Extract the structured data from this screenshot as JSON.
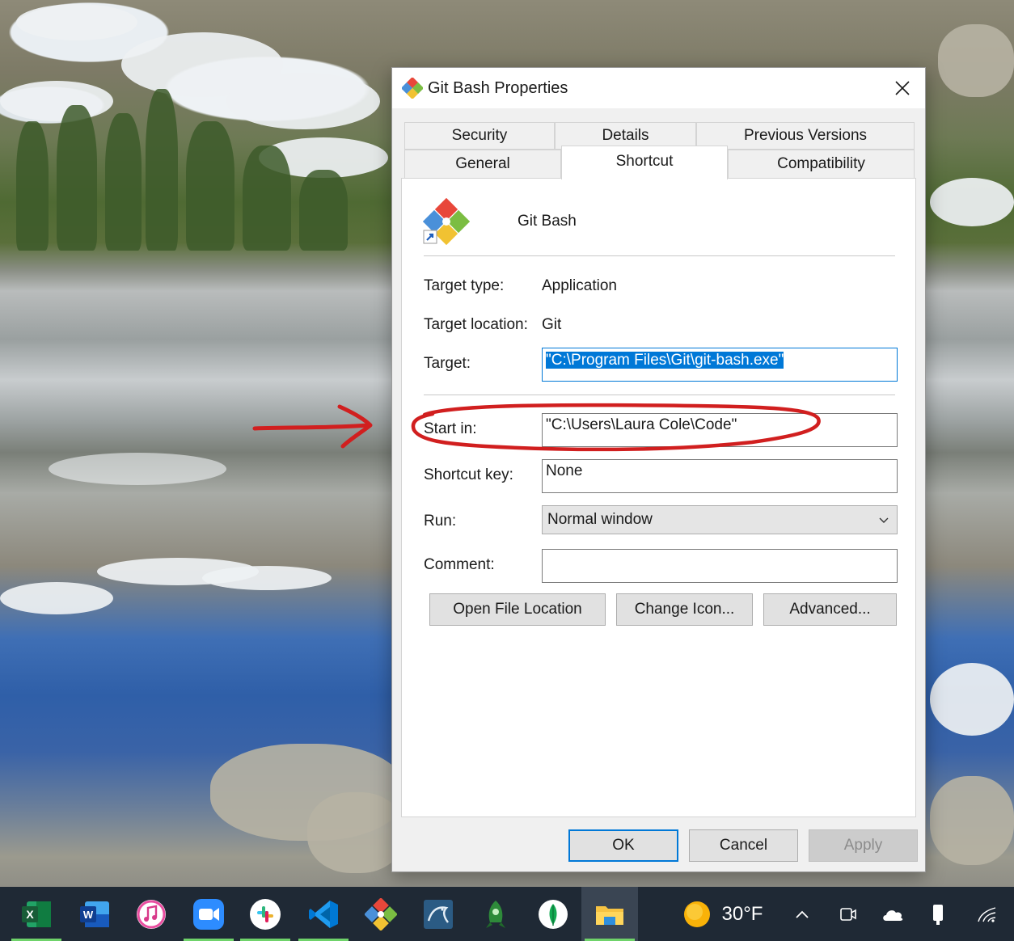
{
  "window": {
    "title": "Git Bash Properties",
    "close_icon": "close-icon"
  },
  "tabs": {
    "row1": [
      "Security",
      "Details",
      "Previous Versions"
    ],
    "row2": [
      "General",
      "Shortcut",
      "Compatibility"
    ],
    "active": "Shortcut"
  },
  "shortcut": {
    "app_name": "Git Bash",
    "target_type_label": "Target type:",
    "target_type_value": "Application",
    "target_location_label": "Target location:",
    "target_location_value": "Git",
    "target_label": "Target:",
    "target_value": "\"C:\\Program Files\\Git\\git-bash.exe\"",
    "start_in_label": "Start in:",
    "start_in_value": "\"C:\\Users\\Laura Cole\\Code\"",
    "shortcut_key_label": "Shortcut key:",
    "shortcut_key_value": "None",
    "run_label": "Run:",
    "run_value": "Normal window",
    "comment_label": "Comment:",
    "comment_value": "",
    "open_file_location": "Open File Location",
    "change_icon": "Change Icon...",
    "advanced": "Advanced..."
  },
  "footer": {
    "ok": "OK",
    "cancel": "Cancel",
    "apply": "Apply"
  },
  "taskbar": {
    "apps": [
      "excel-icon",
      "word-icon",
      "itunes-icon",
      "zoom-icon",
      "slack-icon",
      "vscode-icon",
      "git-icon",
      "mysql-workbench-icon",
      "robo3t-icon",
      "mongodb-icon",
      "file-explorer-icon"
    ],
    "temperature": "30°F"
  },
  "colors": {
    "accent": "#0078d7",
    "annotation": "#d11f1f"
  }
}
